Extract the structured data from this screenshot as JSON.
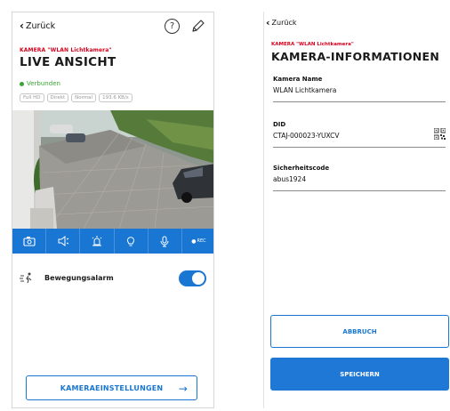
{
  "left": {
    "back_label": "Zurück",
    "help_glyph": "?",
    "camera_label": "KAMERA \"WLAN Lichtkamera\"",
    "title": "LIVE ANSICHT",
    "status": "Verbunden",
    "chips": [
      "Full HD",
      "Direkt",
      "Normal",
      "193.6 KB/s"
    ],
    "toolbar": {
      "items": [
        "snapshot-icon",
        "speaker-icon",
        "siren-icon",
        "light-bulb-icon",
        "microphone-icon",
        "record-icon"
      ],
      "rec_label": "REC"
    },
    "alarm_label": "Bewegungsalarm",
    "alarm_enabled": true,
    "settings_button": "KAMERAEINSTELLUNGEN",
    "settings_arrow": "→"
  },
  "right": {
    "back_label": "Zurück",
    "camera_label": "KAMERA \"WLAN Lichtkamera\"",
    "title": "KAMERA-INFORMATIONEN",
    "fields": [
      {
        "label": "Kamera Name",
        "value": "WLAN Lichtkamera"
      },
      {
        "label": "DID",
        "value": "CTAJ-000023-YUXCV"
      },
      {
        "label": "Sicherheitscode",
        "value": "abus1924"
      }
    ],
    "cancel_button": "ABBRUCH",
    "save_button": "SPEICHERN"
  },
  "colors": {
    "accent": "#1976d2",
    "brand_red": "#d6001c",
    "connected_green": "#3aa535"
  }
}
